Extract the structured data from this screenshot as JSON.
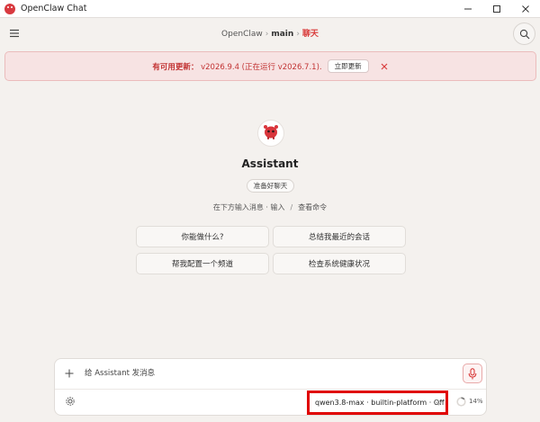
{
  "window": {
    "title": "OpenClaw Chat",
    "controls": [
      "minimize-icon",
      "maximize-icon",
      "close-icon"
    ]
  },
  "header": {
    "breadcrumb": {
      "root": "OpenClaw",
      "branch": "main",
      "page": "聊天",
      "separator": "›"
    },
    "icons": {
      "menu": "hamburger-menu-icon",
      "search": "search-icon"
    }
  },
  "banner": {
    "label": "有可用更新：",
    "version_text": "v2026.9.4 (正在运行 v2026.7.1).",
    "button": "立即更新",
    "close_icon": "close-icon",
    "color": "#c23333"
  },
  "assistant": {
    "name": "Assistant",
    "status": "准备好聊天",
    "hint_left": "在下方输入消息 · 输入",
    "hint_sep": "/",
    "hint_right": "查看命令",
    "avatar_icon": "red-mascot-icon"
  },
  "suggestions": [
    {
      "label": "你能做什么?"
    },
    {
      "label": "总结我最近的会话"
    },
    {
      "label": "帮我配置一个频道"
    },
    {
      "label": "检查系统健康状况"
    }
  ],
  "composer": {
    "placeholder": "给 Assistant 发消息",
    "model": "qwen3.8-max · builtin-platform · Off",
    "context_usage": "14%",
    "context_fraction": 0.14,
    "icons": {
      "attach": "plus-icon",
      "mic": "microphone-icon",
      "settings": "gear-icon",
      "dropdown": "chevron-down-icon"
    }
  },
  "colors": {
    "accent": "#d93b3b",
    "background": "#f4f1ee",
    "highlight_box": "#e00000"
  }
}
